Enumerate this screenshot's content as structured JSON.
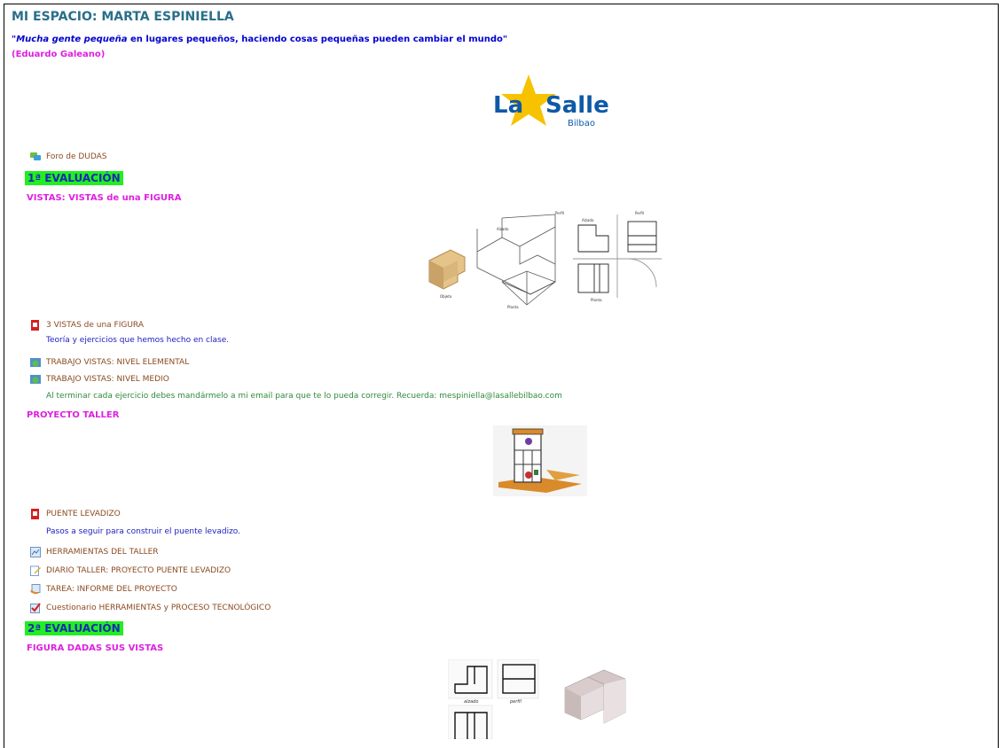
{
  "page": {
    "title": "MI ESPACIO: MARTA ESPINIELLA",
    "quote_open": "\"",
    "quote_italic": "Mucha gente pequeña",
    "quote_rest": " en lugares pequeños, haciendo cosas pequeñas pueden cambiar el mundo\"",
    "author": "(Eduardo Galeano)"
  },
  "logo": {
    "text_la": "La",
    "text_salle": "Salle",
    "text_city": "Bilbao",
    "color_blue": "#0d5aa7",
    "color_star": "#f7c200"
  },
  "forum": {
    "label": "Foro de DUDAS",
    "icon": "forum-icon"
  },
  "eval1": {
    "label": "1ª EVALUACIÓN",
    "section_vistas": "VISTAS: VISTAS de una FIGURA",
    "figure_labels": {
      "alzado": "Alzado",
      "perfil": "Perfil",
      "planta": "Planta",
      "objeto": "Objeto"
    },
    "items": [
      {
        "label": "3 VISTAS de una FIGURA",
        "icon": "pdf-icon"
      },
      {
        "label": "TRABAJO VISTAS: NIVEL ELEMENTAL",
        "icon": "globe-icon"
      },
      {
        "label": "TRABAJO VISTAS: NIVEL MEDIO",
        "icon": "globe-icon"
      }
    ],
    "desc_vistas": "Teoría y ejercicios que hemos hecho en clase.",
    "desc_medio": "Al terminar cada ejercicio debes mandármelo a mi email para que te lo pueda corregir. Recuerda: mespiniella@lasallebilbao.com",
    "section_proyecto": "PROYECTO TALLER",
    "proyecto_items": [
      {
        "label": "PUENTE LEVADIZO",
        "icon": "pdf-icon"
      },
      {
        "label": "HERRAMIENTAS DEL TALLER",
        "icon": "image-icon"
      },
      {
        "label": "DIARIO TALLER: PROYECTO PUENTE LEVADIZO",
        "icon": "journal-icon"
      },
      {
        "label": "TAREA: INFORME DEL PROYECTO",
        "icon": "assignment-icon"
      },
      {
        "label": "Cuestionario HERRAMIENTAS y PROCESO TECNOLÓGICO",
        "icon": "quiz-icon"
      }
    ],
    "desc_puente": "Pasos a seguir para construir el puente levadizo."
  },
  "eval2": {
    "label": "2ª EVALUACIÓN",
    "section_figura": "FIGURA DADAS SUS VISTAS",
    "figure_labels": {
      "alzado": "alzado",
      "perfil": "perfil"
    }
  }
}
